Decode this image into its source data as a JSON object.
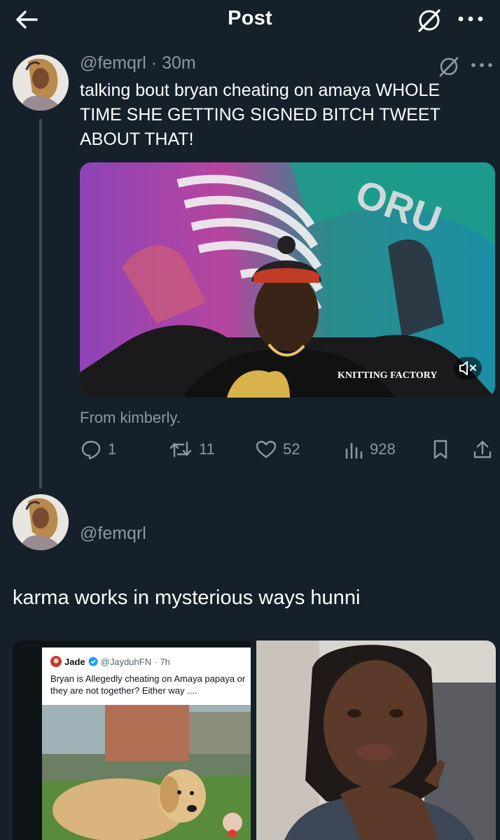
{
  "header": {
    "title": "Post"
  },
  "tweet": {
    "handle": "@femqrl",
    "time": "30m",
    "text": "talking bout bryan cheating on amaya WHOLE TIME SHE GETTING SIGNED BITCH TWEET ABOUT THAT!",
    "video_overlay_text": "KNITTING FACTORY",
    "source_note": "From kimberly.",
    "actions": {
      "replies": "1",
      "retweets": "11",
      "likes": "52",
      "views": "928"
    }
  },
  "reply": {
    "handle": "@femqrl",
    "text": "karma works in mysterious ways hunni",
    "quoted_tweet": {
      "name": "Jade",
      "handle": "@JayduhFN",
      "time": "7h",
      "text": "Bryan is Allegedly cheating on Amaya papaya or they are not together? Either way ...."
    }
  },
  "colors": {
    "background": "#15202b",
    "muted": "#8b98a5",
    "thread_line": "#3b4a5a"
  },
  "icons": [
    "back-arrow-icon",
    "grok-icon",
    "more-icon",
    "reply-icon",
    "retweet-icon",
    "like-icon",
    "views-icon",
    "bookmark-icon",
    "share-icon",
    "mute-icon",
    "verified-icon"
  ]
}
